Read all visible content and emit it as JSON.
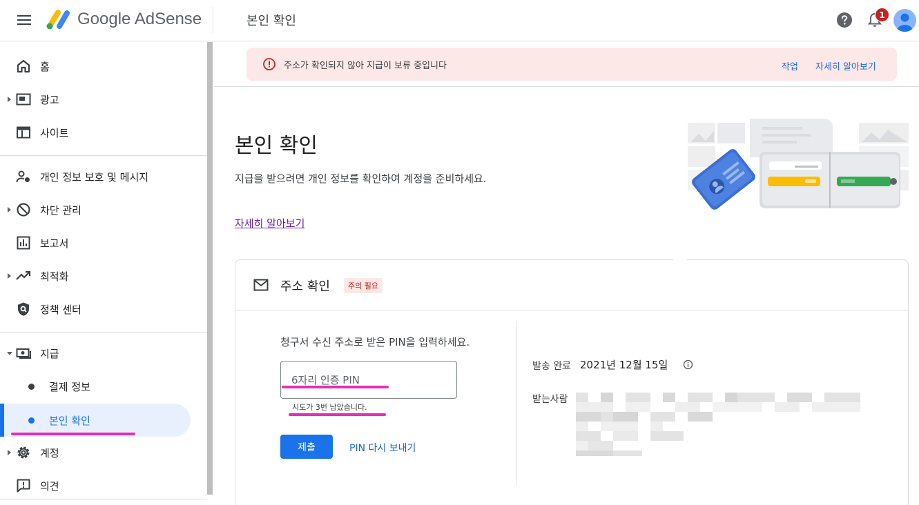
{
  "app": {
    "brand_name": "Google AdSense",
    "page_header_title": "본인 확인",
    "notification_count": "1"
  },
  "sidebar": {
    "items": [
      {
        "label": "홈",
        "icon": "home-icon",
        "expandable": false
      },
      {
        "label": "광고",
        "icon": "ads-icon",
        "expandable": true
      },
      {
        "label": "사이트",
        "icon": "sites-icon",
        "expandable": false
      },
      {
        "label": "개인 정보 보호 및 메시지",
        "icon": "privacy-icon",
        "expandable": false
      },
      {
        "label": "차단 관리",
        "icon": "block-icon",
        "expandable": true
      },
      {
        "label": "보고서",
        "icon": "reports-icon",
        "expandable": false
      },
      {
        "label": "최적화",
        "icon": "trending-icon",
        "expandable": true
      },
      {
        "label": "정책 센터",
        "icon": "policy-icon",
        "expandable": false
      },
      {
        "label": "지급",
        "icon": "payments-icon",
        "expandable": true,
        "expanded": true
      },
      {
        "label": "결제 정보",
        "sub": true
      },
      {
        "label": "본인 확인",
        "sub": true,
        "active": true
      },
      {
        "label": "계정",
        "icon": "gear-icon",
        "expandable": true
      },
      {
        "label": "의견",
        "icon": "feedback-icon",
        "expandable": false
      }
    ]
  },
  "alert": {
    "message": "주소가 확인되지 않아 지급이 보류 중입니다",
    "action_label": "작업",
    "learn_more_label": "자세히 알아보기"
  },
  "hero": {
    "title": "본인 확인",
    "description": "지급을 받으려면 개인 정보를 확인하여 계정을 준비하세요.",
    "link_label": "자세히 알아보기"
  },
  "card": {
    "title": "주소 확인",
    "badge": "주의 필요",
    "pin_prompt": "청구서 수신 주소로 받은 PIN을 입력하세요.",
    "pin_placeholder": "6자리 인증 PIN",
    "attempts_hint": "시도가 3번 남았습니다.",
    "submit_label": "제출",
    "resend_label": "PIN 다시 보내기",
    "sent_label": "발송 완료",
    "sent_date": "2021년 12월 15일",
    "recipient_label": "받는사람"
  },
  "colors": {
    "accent": "#1a73e8",
    "alert_bg": "#fce8e6",
    "alert_red": "#c5221f",
    "annotation_pink": "#e52fb6"
  }
}
